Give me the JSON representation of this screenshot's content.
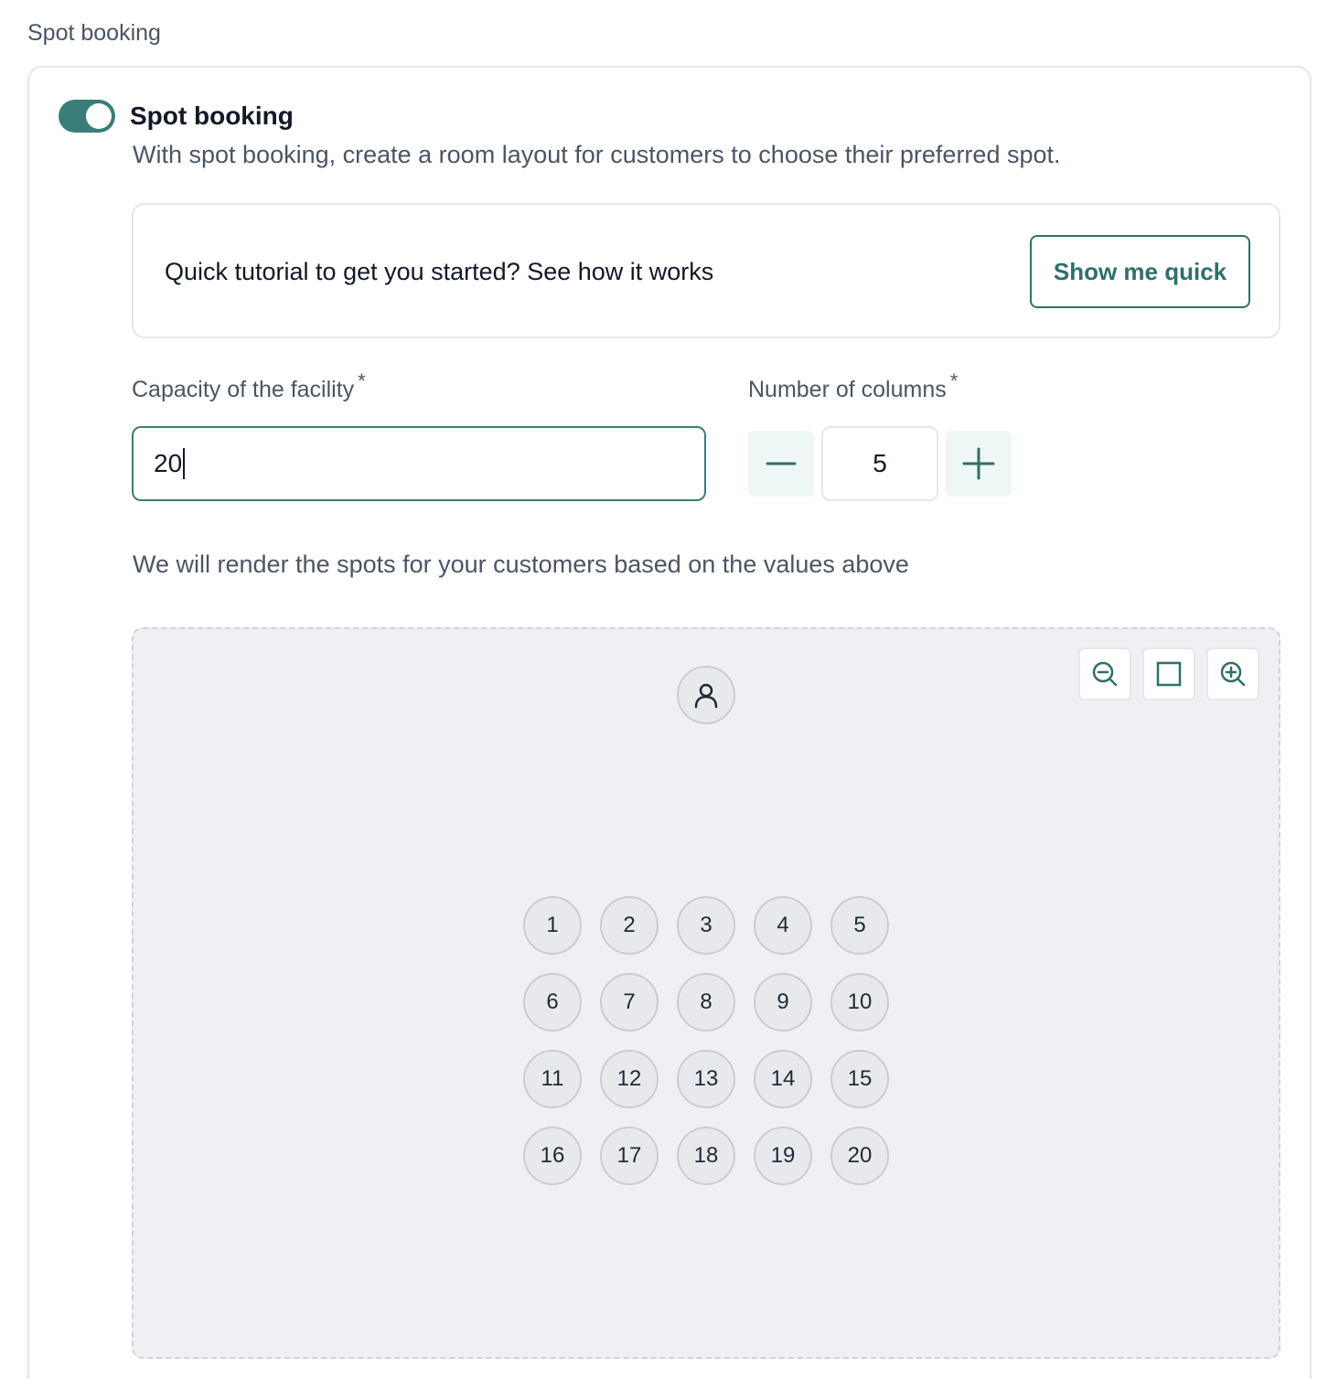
{
  "section": {
    "title": "Spot booking"
  },
  "feature": {
    "toggle_on": true,
    "title": "Spot booking",
    "description": "With spot booking, create a room layout for customers to choose their preferred spot."
  },
  "tutorial": {
    "text": "Quick tutorial to get you started? See how it works",
    "button_label": "Show me quick"
  },
  "capacity": {
    "label": "Capacity of the facility",
    "required_mark": "*",
    "value": "20"
  },
  "columns": {
    "label": "Number of columns",
    "required_mark": "*",
    "value": "5"
  },
  "hint": "We will render the spots for your customers based on the values above",
  "layout": {
    "zoom_controls": [
      "zoom-out-icon",
      "fit-screen-icon",
      "zoom-in-icon"
    ],
    "instructor_icon": "user-icon",
    "spots": [
      "1",
      "2",
      "3",
      "4",
      "5",
      "6",
      "7",
      "8",
      "9",
      "10",
      "11",
      "12",
      "13",
      "14",
      "15",
      "16",
      "17",
      "18",
      "19",
      "20"
    ]
  },
  "colors": {
    "accent": "#3a7d78",
    "canvas_bg": "#eff0f3",
    "spot_bg": "#e8e9ec"
  }
}
